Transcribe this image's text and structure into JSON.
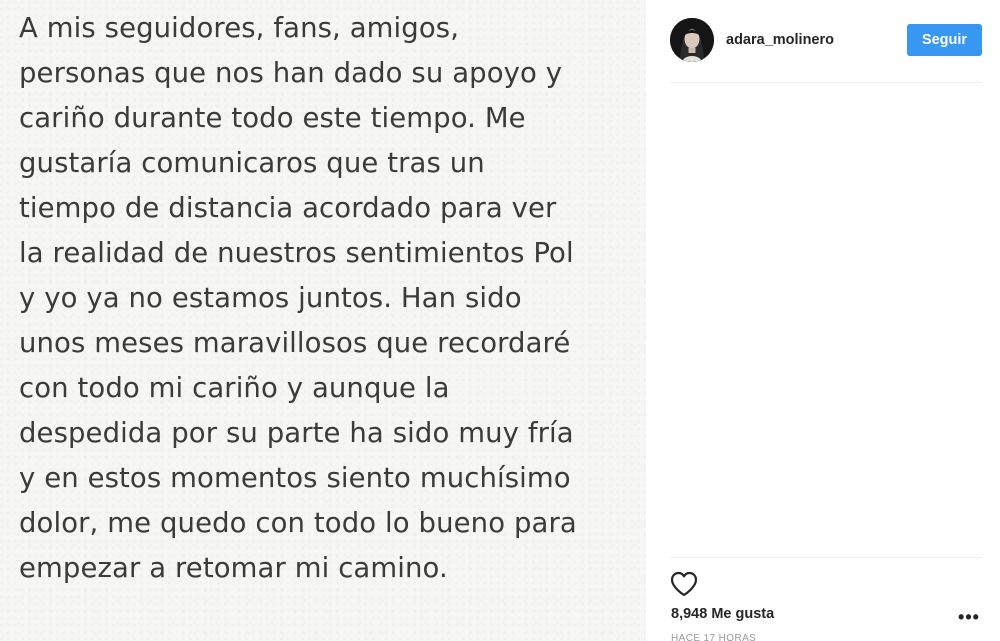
{
  "post": {
    "text": "A mis seguidores, fans, amigos,\npersonas que nos han dado su apoyo y\ncariño durante todo este tiempo. Me\ngustaría comunicaros que tras un\ntiempo de distancia acordado para ver\nla realidad de nuestros sentimientos Pol\ny yo ya no estamos juntos. Han sido\nunos meses maravillosos que recordaré\ncon todo mi cariño y aunque la\ndespedida por su parte ha sido muy fría\ny en estos momentos siento muchísimo\ndolor, me quedo con todo lo bueno para\nempezar a retomar mi camino."
  },
  "sidebar": {
    "username": "adara_molinero",
    "avatar_icon": "profile-photo",
    "follow_label": "Seguir",
    "like_icon": "heart-outline-icon",
    "likes_text": "8,948 Me gusta",
    "more_icon": "ellipsis-icon",
    "more_label": "•••",
    "timestamp": "HACE 17 HORAS"
  },
  "colors": {
    "accent": "#3897f0",
    "text_primary": "#262626",
    "post_text": "#3b3b3b",
    "media_background": "#f6f6f4"
  }
}
